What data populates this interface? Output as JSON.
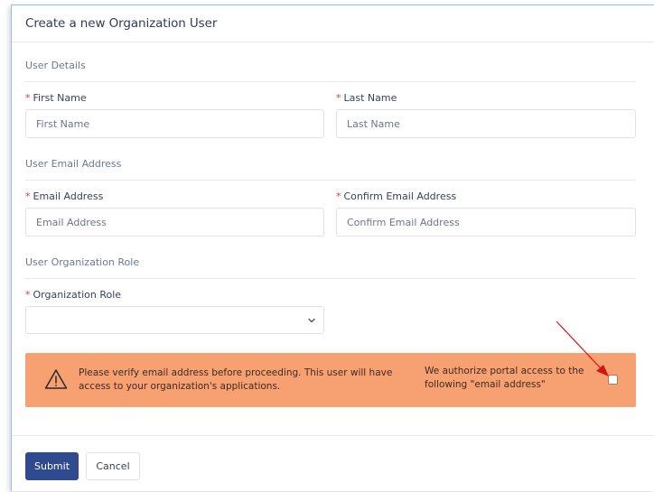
{
  "form": {
    "title": "Create a new Organization User",
    "sections": {
      "user_details": "User Details",
      "user_email": "User Email Address",
      "user_role": "User Organization Role"
    },
    "required_marker": "*",
    "fields": {
      "first_name": {
        "label": "First Name",
        "placeholder": "First Name",
        "value": ""
      },
      "last_name": {
        "label": "Last Name",
        "placeholder": "Last Name",
        "value": ""
      },
      "email": {
        "label": "Email Address",
        "placeholder": "Email Address",
        "value": ""
      },
      "confirm_email": {
        "label": "Confirm Email Address",
        "placeholder": "Confirm Email Address",
        "value": ""
      },
      "org_role": {
        "label": "Organization Role",
        "selected": ""
      }
    },
    "alert": {
      "message": "Please verify email address before proceeding. This user will have access to your organization's applications.",
      "consent_text": "We authorize portal access to the following \"email address\"",
      "consent_checked": false,
      "icon": "warning-triangle-icon",
      "color": "#f7a072"
    },
    "buttons": {
      "submit": "Submit",
      "cancel": "Cancel"
    },
    "colors": {
      "primary": "#2f4a8f",
      "required": "#e03a3a",
      "annotation_arrow": "#d01515"
    }
  }
}
